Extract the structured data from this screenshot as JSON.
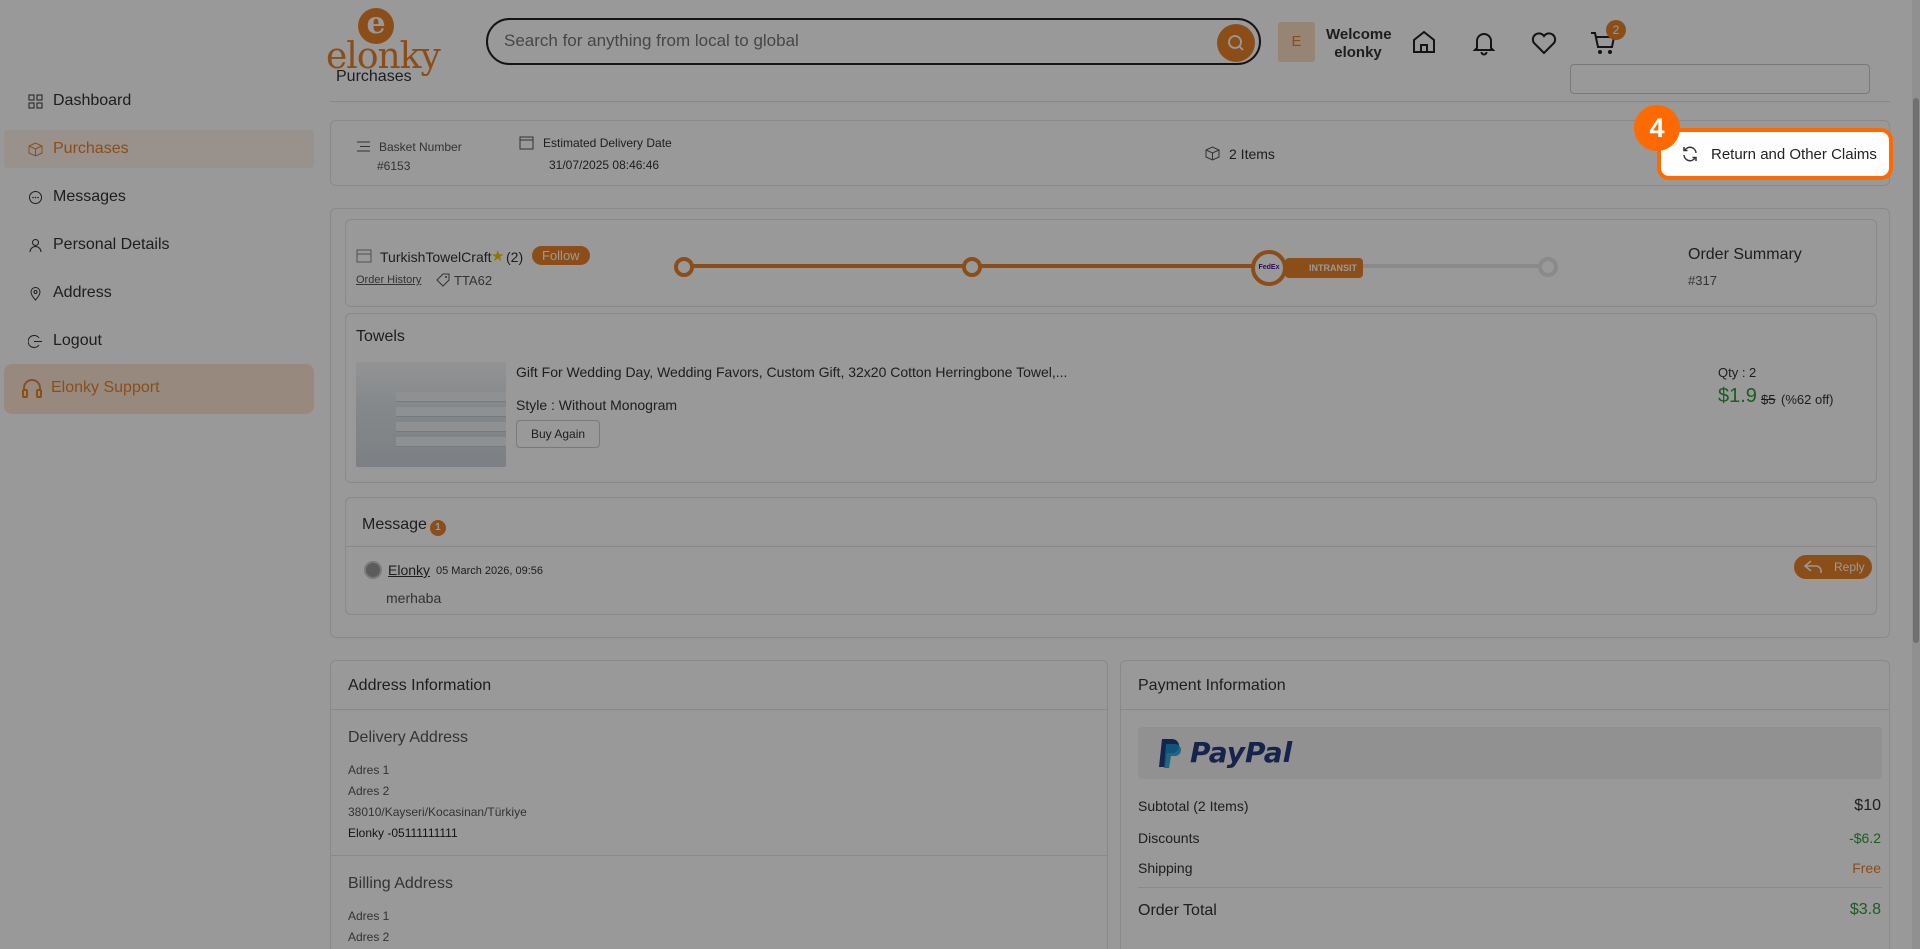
{
  "brand": {
    "logo_letter": "e",
    "name": "elonky"
  },
  "header": {
    "search_placeholder": "Search for anything from local to global",
    "avatar_initial": "E",
    "welcome_line1": "Welcome",
    "welcome_line2": "elonky",
    "cart_count": "2",
    "icons": [
      "home-icon",
      "bell-icon",
      "heart-icon",
      "cart-icon"
    ]
  },
  "sidebar": {
    "items": [
      {
        "label": "Dashboard",
        "icon": "grid-icon"
      },
      {
        "label": "Purchases",
        "icon": "box-icon",
        "active": true
      },
      {
        "label": "Messages",
        "icon": "chat-icon"
      },
      {
        "label": "Personal Details",
        "icon": "user-icon"
      },
      {
        "label": "Address",
        "icon": "location-icon"
      },
      {
        "label": "Logout",
        "icon": "logout-icon"
      }
    ],
    "support_label": "Elonky Support"
  },
  "page": {
    "title_partial": "Purchases"
  },
  "basket": {
    "basket_number_label": "Basket Number",
    "basket_number": "#6153",
    "delivery_label": "Estimated Delivery Date",
    "delivery_date": "31/07/2025 08:46:46",
    "items_count": "2 Items",
    "return_button": "Return and Other Claims"
  },
  "order": {
    "store_name": "TurkishTowelCraft",
    "store_rating_count": "(2)",
    "follow_label": "Follow",
    "order_history_label": "Order History",
    "coupon_code": "TTA62",
    "tracking_status": "INTRANSIT",
    "carrier_label": "FedEx",
    "summary_label": "Order Summary",
    "summary_number": "#317",
    "category": "Towels",
    "product_title": "Gift For Wedding Day, Wedding Favors, Custom Gift, 32x20 Cotton Herringbone Towel,...",
    "style": "Style : Without Monogram",
    "buy_again": "Buy Again",
    "qty": "Qty : 2",
    "price": "$1.9",
    "old_price": "$5",
    "discount": "(%62 off)"
  },
  "message": {
    "title": "Message",
    "count": "1",
    "sender": "Elonky",
    "date": "05 March 2026, 09:56",
    "body": "merhaba",
    "reply_label": "Reply"
  },
  "address": {
    "section_title": "Address Information",
    "delivery_title": "Delivery Address",
    "delivery_lines": [
      "Adres 1",
      "Adres 2",
      "38010/Kayseri/Kocasinan/Türkiye",
      "Elonky -05111111111"
    ],
    "billing_title": "Billing Address",
    "billing_lines": [
      "Adres 1",
      "Adres 2"
    ]
  },
  "payment": {
    "section_title": "Payment Information",
    "method": "PayPal",
    "subtotal_label": "Subtotal (2 Items)",
    "subtotal_value": "$10",
    "discounts_label": "Discounts",
    "discounts_value": "-$6.2",
    "shipping_label": "Shipping",
    "shipping_value": "Free",
    "total_label": "Order Total",
    "total_value": "$3.8"
  },
  "tutorial": {
    "step_number": "4"
  },
  "colors": {
    "accent": "#e8822a",
    "highlight": "#ff6a00",
    "price_green": "#2e9b3a"
  }
}
